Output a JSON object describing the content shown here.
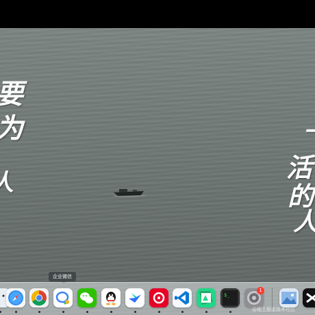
{
  "desktop": {
    "calligraphy_left": [
      "要",
      "为",
      "人"
    ],
    "calligraphy_right": [
      "一",
      "活",
      "的",
      "人"
    ]
  },
  "dock": {
    "tooltip": "企业微信",
    "apps": [
      {
        "name": "Finder",
        "icon": "finder-icon",
        "running": true
      },
      {
        "name": "Safari",
        "icon": "safari-icon",
        "running": true
      },
      {
        "name": "Chrome",
        "icon": "chrome-icon",
        "running": true
      },
      {
        "name": "企业微信",
        "icon": "wecom-icon",
        "running": true
      },
      {
        "name": "WeChat",
        "icon": "wechat-icon",
        "running": true
      },
      {
        "name": "QQ",
        "icon": "qq-icon",
        "running": true
      },
      {
        "name": "Feishu",
        "icon": "feishu-icon",
        "running": true
      },
      {
        "name": "NetEase Cloud Music",
        "icon": "netease-music-icon",
        "running": true
      },
      {
        "name": "Visual Studio Code",
        "icon": "vscode-icon",
        "running": true
      },
      {
        "name": "Pycharm",
        "icon": "pycharm-icon",
        "running": true
      },
      {
        "name": "Terminal",
        "icon": "terminal-icon",
        "running": true
      },
      {
        "name": "System Preferences",
        "icon": "system-preferences-icon",
        "running": false
      },
      {
        "name": "Preview",
        "icon": "preview-icon",
        "running": false
      },
      {
        "name": "CapCut",
        "icon": "capcut-icon",
        "running": false
      }
    ],
    "system_preferences_badge": "1"
  },
  "watermark": "@稀土掘金技术社区",
  "colors": {
    "sea": "#6f7875",
    "dock": "#dfe4e6",
    "badge": "#ff3b30"
  }
}
